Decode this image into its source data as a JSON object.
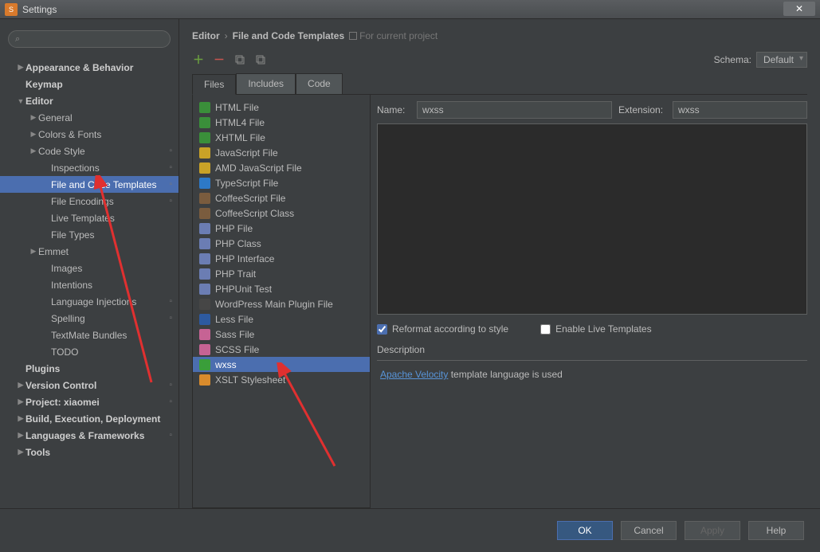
{
  "window": {
    "title": "Settings"
  },
  "breadcrumb": {
    "part1": "Editor",
    "part2": "File and Code Templates",
    "scope": "For current project"
  },
  "schema": {
    "label": "Schema:",
    "value": "Default"
  },
  "tabs": {
    "files": "Files",
    "includes": "Includes",
    "code": "Code"
  },
  "sidebar": {
    "items": [
      {
        "label": "Appearance & Behavior",
        "bold": true,
        "arrow": "▶",
        "indent": 0
      },
      {
        "label": "Keymap",
        "bold": true,
        "arrow": "",
        "indent": 0
      },
      {
        "label": "Editor",
        "bold": true,
        "arrow": "▼",
        "indent": 0
      },
      {
        "label": "General",
        "arrow": "▶",
        "indent": 1
      },
      {
        "label": "Colors & Fonts",
        "arrow": "▶",
        "indent": 1
      },
      {
        "label": "Code Style",
        "arrow": "▶",
        "indent": 1,
        "proj": true
      },
      {
        "label": "Inspections",
        "arrow": "",
        "indent": 2,
        "proj": true
      },
      {
        "label": "File and Code Templates",
        "arrow": "",
        "indent": 2,
        "selected": true,
        "proj": true
      },
      {
        "label": "File Encodings",
        "arrow": "",
        "indent": 2,
        "proj": true
      },
      {
        "label": "Live Templates",
        "arrow": "",
        "indent": 2
      },
      {
        "label": "File Types",
        "arrow": "",
        "indent": 2
      },
      {
        "label": "Emmet",
        "arrow": "▶",
        "indent": 1
      },
      {
        "label": "Images",
        "arrow": "",
        "indent": 2
      },
      {
        "label": "Intentions",
        "arrow": "",
        "indent": 2
      },
      {
        "label": "Language Injections",
        "arrow": "",
        "indent": 2,
        "proj": true
      },
      {
        "label": "Spelling",
        "arrow": "",
        "indent": 2,
        "proj": true
      },
      {
        "label": "TextMate Bundles",
        "arrow": "",
        "indent": 2
      },
      {
        "label": "TODO",
        "arrow": "",
        "indent": 2
      },
      {
        "label": "Plugins",
        "bold": true,
        "arrow": "",
        "indent": 0
      },
      {
        "label": "Version Control",
        "bold": true,
        "arrow": "▶",
        "indent": 0,
        "proj": true
      },
      {
        "label": "Project: xiaomei",
        "bold": true,
        "arrow": "▶",
        "indent": 0,
        "proj": true
      },
      {
        "label": "Build, Execution, Deployment",
        "bold": true,
        "arrow": "▶",
        "indent": 0
      },
      {
        "label": "Languages & Frameworks",
        "bold": true,
        "arrow": "▶",
        "indent": 0,
        "proj": true
      },
      {
        "label": "Tools",
        "bold": true,
        "arrow": "▶",
        "indent": 0
      }
    ]
  },
  "templates": [
    {
      "label": "HTML File",
      "icon": "ic-html"
    },
    {
      "label": "HTML4 File",
      "icon": "ic-html"
    },
    {
      "label": "XHTML File",
      "icon": "ic-xhtml"
    },
    {
      "label": "JavaScript File",
      "icon": "ic-js"
    },
    {
      "label": "AMD JavaScript File",
      "icon": "ic-js"
    },
    {
      "label": "TypeScript File",
      "icon": "ic-ts"
    },
    {
      "label": "CoffeeScript File",
      "icon": "ic-cs"
    },
    {
      "label": "CoffeeScript Class",
      "icon": "ic-cs"
    },
    {
      "label": "PHP File",
      "icon": "ic-php"
    },
    {
      "label": "PHP Class",
      "icon": "ic-php"
    },
    {
      "label": "PHP Interface",
      "icon": "ic-php"
    },
    {
      "label": "PHP Trait",
      "icon": "ic-php"
    },
    {
      "label": "PHPUnit Test",
      "icon": "ic-php"
    },
    {
      "label": "WordPress Main Plugin File",
      "icon": "ic-wp"
    },
    {
      "label": "Less File",
      "icon": "ic-less"
    },
    {
      "label": "Sass File",
      "icon": "ic-sass"
    },
    {
      "label": "SCSS File",
      "icon": "ic-scss"
    },
    {
      "label": "wxss",
      "icon": "ic-css",
      "selected": true
    },
    {
      "label": "XSLT Stylesheet",
      "icon": "ic-xslt"
    }
  ],
  "form": {
    "name_label": "Name:",
    "name_value": "wxss",
    "ext_label": "Extension:",
    "ext_value": "wxss",
    "reformat": "Reformat according to style",
    "live": "Enable Live Templates",
    "desc_label": "Description",
    "desc_link": "Apache Velocity",
    "desc_rest": " template language is used"
  },
  "footer": {
    "ok": "OK",
    "cancel": "Cancel",
    "apply": "Apply",
    "help": "Help"
  }
}
